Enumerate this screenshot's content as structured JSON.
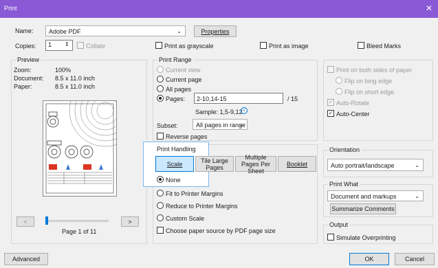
{
  "window": {
    "title": "Print",
    "close": "✕"
  },
  "top": {
    "name_label": "Name:",
    "name_value": "Adobe PDF",
    "properties_label": "Properties",
    "copies_label": "Copies:",
    "copies_value": "1",
    "collate_label": "Collate",
    "grayscale_label": "Print as grayscale",
    "print_as_image_label": "Print as image",
    "bleed_marks_label": "Bleed Marks"
  },
  "preview": {
    "title": "Preview",
    "zoom_label": "Zoom:",
    "zoom_value": "100%",
    "document_label": "Document:",
    "document_value": "8.5 x 11.0 inch",
    "paper_label": "Paper:",
    "paper_value": "8.5 x 11.0 inch",
    "prev_label": "<",
    "next_label": ">",
    "page_text": "Page 1 of 11",
    "page_progress": 0.0
  },
  "range": {
    "title": "Print Range",
    "current_view": "Current view",
    "current_page": "Current page",
    "all_pages": "All pages",
    "pages_label": "Pages:",
    "pages_value": "2-10,14-15",
    "pages_total": "/ 15",
    "sample": "Sample: 1,5-9,12",
    "subset_label": "Subset:",
    "subset_value": "All pages in range",
    "reverse_label": "Reverse pages"
  },
  "handling": {
    "title": "Print Handling",
    "scale": "Scale",
    "tile": "Tile Large Pages",
    "multiple": "Multiple Pages Per Sheet",
    "booklet": "Booklet",
    "none": "None",
    "fit": "Fit to Printer Margins",
    "reduce": "Reduce to Printer Margins",
    "custom": "Custom Scale",
    "paper_source": "Choose paper source by PDF page size"
  },
  "duplex": {
    "both_sides": "Print on both sides of paper",
    "long_edge": "Flip on long edge",
    "short_edge": "Flip on short edge",
    "auto_rotate": "Auto-Rotate",
    "auto_center": "Auto-Center"
  },
  "orientation": {
    "title": "Orientation",
    "value": "Auto portrait/landscape"
  },
  "print_what": {
    "title": "Print What",
    "value": "Document and markups",
    "summarize": "Summarize Comments"
  },
  "output": {
    "title": "Output",
    "simulate": "Simulate Overprinting"
  },
  "footer": {
    "advanced": "Advanced",
    "ok": "OK",
    "cancel": "Cancel"
  },
  "colors": {
    "titlebar": "#8a5ad6",
    "accent": "#0078d7",
    "selected_tab": "#cce8ff"
  }
}
